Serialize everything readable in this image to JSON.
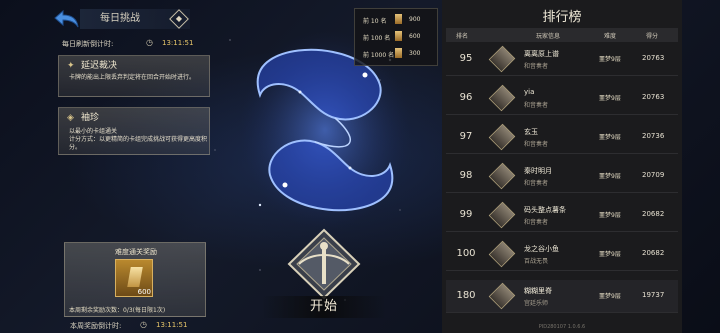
{
  "header": {
    "title": "每日挑战",
    "info_icon": "◆",
    "refresh_label": "每日刷新倒计时:",
    "refresh_time": "13:11:51"
  },
  "modifiers": [
    {
      "title": "延迟裁决",
      "desc": "卡牌的能出上限丢弃判定将在回合开始时进行。"
    },
    {
      "title": "袖珍",
      "desc": "以最小的卡组通关\n计分方式：以更精简的卡组完成挑战可获得更高度积分。"
    }
  ],
  "reward": {
    "title": "难度通关奖励",
    "amount": "600",
    "count_text": "本周剩余奖励次数：0/3(每日限1次)"
  },
  "weekly": {
    "label": "本周奖励倒计时:",
    "time": "13:11:51"
  },
  "start_button": "开始",
  "thresholds": [
    {
      "rank": "前 10 名",
      "points": "900"
    },
    {
      "rank": "前 100 名",
      "points": "600"
    },
    {
      "rank": "前 1000 名",
      "points": "300"
    }
  ],
  "leaderboard": {
    "title": "排行榜",
    "columns": {
      "rank": "排名",
      "player": "玩家信息",
      "difficulty": "难度",
      "score": "得分"
    },
    "rows": [
      {
        "rank": "95",
        "name": "离离原上谱",
        "tag": "和音奏者",
        "level": "噩梦9层",
        "score": "20763"
      },
      {
        "rank": "96",
        "name": "yia",
        "tag": "和音奏者",
        "level": "噩梦9层",
        "score": "20763"
      },
      {
        "rank": "97",
        "name": "玄玉",
        "tag": "和音奏者",
        "level": "噩梦9层",
        "score": "20736"
      },
      {
        "rank": "98",
        "name": "秦时明月",
        "tag": "和音奏者",
        "level": "噩梦9层",
        "score": "20709"
      },
      {
        "rank": "99",
        "name": "码头整点薯条",
        "tag": "和音奏者",
        "level": "噩梦9层",
        "score": "20682"
      },
      {
        "rank": "100",
        "name": "龙之谷小鱼",
        "tag": "百战无畏",
        "level": "噩梦9层",
        "score": "20682"
      },
      {
        "rank": "180",
        "name": "糊糊里脊",
        "tag": "宫廷乐师",
        "level": "噩梦9层",
        "score": "19737"
      }
    ],
    "version": "PID280107 1.0.6.6"
  },
  "colors": {
    "accent_gold": "#e6c56a",
    "constellation_blue": "#4a7cff"
  }
}
